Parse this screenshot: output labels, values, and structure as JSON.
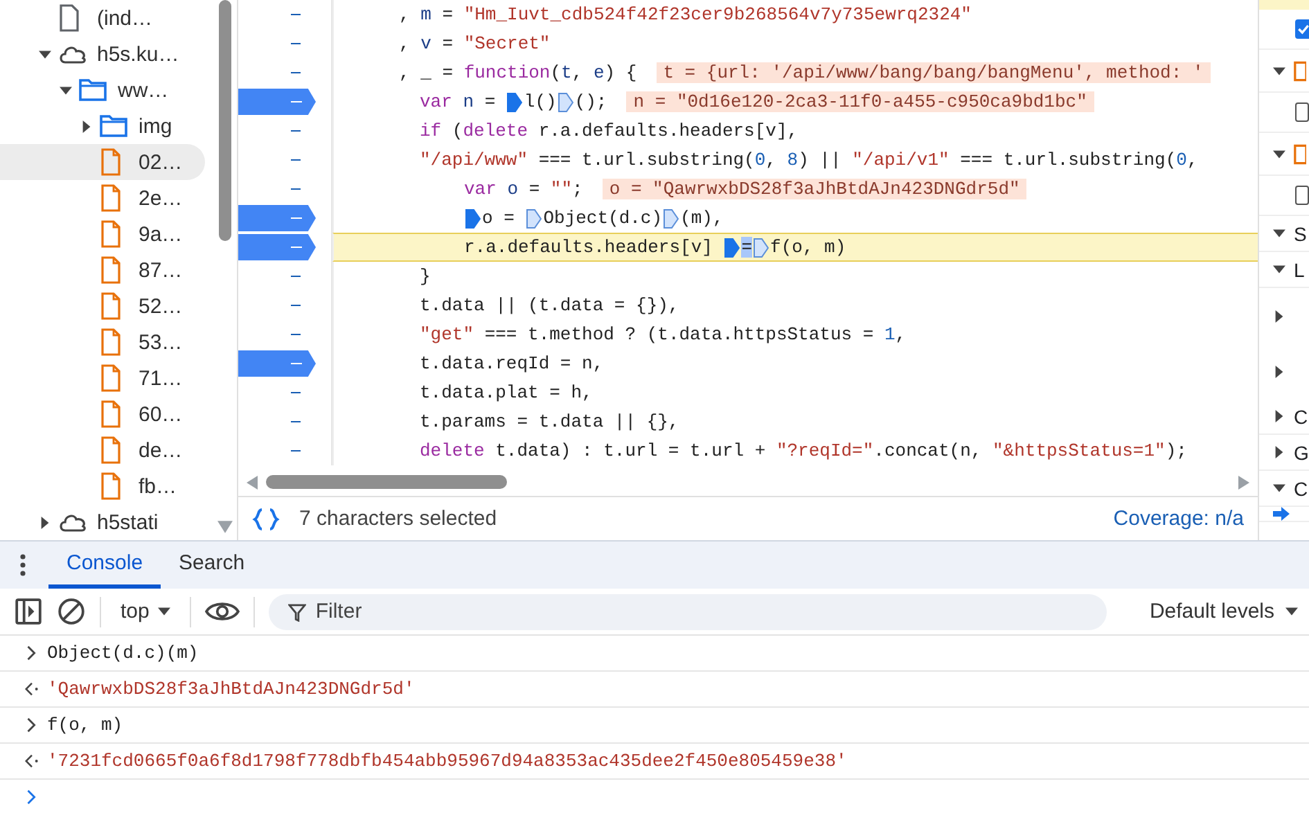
{
  "file_tree": [
    {
      "kind": "page",
      "label": "(ind…",
      "selected": false
    },
    {
      "kind": "cloud",
      "label": "h5s.ku…",
      "expanded": true,
      "selected": false,
      "children": [
        {
          "kind": "folder",
          "label": "ww…",
          "expanded": true,
          "selected": false,
          "children": [
            {
              "kind": "folder",
              "label": "img",
              "expanded": false,
              "selected": false
            },
            {
              "kind": "script",
              "label": "02…",
              "selected": true
            },
            {
              "kind": "script",
              "label": "2e…",
              "selected": false
            },
            {
              "kind": "script",
              "label": "9a…",
              "selected": false
            },
            {
              "kind": "script",
              "label": "87…",
              "selected": false
            },
            {
              "kind": "script",
              "label": "52…",
              "selected": false
            },
            {
              "kind": "script",
              "label": "53…",
              "selected": false
            },
            {
              "kind": "script",
              "label": "71…",
              "selected": false
            },
            {
              "kind": "script",
              "label": "60…",
              "selected": false
            },
            {
              "kind": "script",
              "label": "de…",
              "selected": false
            },
            {
              "kind": "script",
              "label": "fb…",
              "selected": false
            }
          ]
        }
      ]
    },
    {
      "kind": "cloud",
      "label": "h5stati",
      "expanded": false,
      "selected": false
    }
  ],
  "code": {
    "lines": [
      {
        "breakpoint": false,
        "current": false,
        "parts": [
          {
            "kind": "code",
            "tokens": [
              {
                "text": ", ",
                "kind": "plain"
              },
              {
                "text": "m",
                "kind": "def"
              },
              {
                "text": " = ",
                "kind": "plain"
              },
              {
                "text": "\"Hm_Iuvt_cdb524f42f23cer9b268564v7y735ewrq2324\"",
                "kind": "str"
              }
            ]
          }
        ]
      },
      {
        "breakpoint": false,
        "current": false,
        "parts": [
          {
            "kind": "code",
            "tokens": [
              {
                "text": ", ",
                "kind": "plain"
              },
              {
                "text": "v",
                "kind": "def"
              },
              {
                "text": " = ",
                "kind": "plain"
              },
              {
                "text": "\"Secret\"",
                "kind": "str"
              }
            ]
          }
        ]
      },
      {
        "breakpoint": false,
        "current": false,
        "parts": [
          {
            "kind": "code",
            "tokens": [
              {
                "text": ", _ = ",
                "kind": "plain"
              },
              {
                "text": "function",
                "kind": "kw"
              },
              {
                "text": "(",
                "kind": "plain"
              },
              {
                "text": "t",
                "kind": "def"
              },
              {
                "text": ", ",
                "kind": "plain"
              },
              {
                "text": "e",
                "kind": "def"
              },
              {
                "text": ") {",
                "kind": "plain"
              }
            ]
          },
          {
            "kind": "value",
            "text": "t = {url: '/api/www/bang/bang/bangMenu', method: '"
          }
        ],
        "children": [
          {
            "breakpoint": true,
            "current": false,
            "parts": [
              {
                "kind": "code",
                "tokens": [
                  {
                    "text": "var",
                    "kind": "kw"
                  },
                  {
                    "text": " n",
                    "kind": "def"
                  },
                  {
                    "text": " = ",
                    "kind": "plain"
                  }
                ]
              },
              {
                "kind": "marker",
                "active": true
              },
              {
                "kind": "code",
                "tokens": [
                  {
                    "text": "l()",
                    "kind": "plain"
                  }
                ]
              },
              {
                "kind": "marker",
                "active": false
              },
              {
                "kind": "code",
                "tokens": [
                  {
                    "text": "();",
                    "kind": "plain"
                  }
                ]
              },
              {
                "kind": "value",
                "text": "n = \"0d16e120-2ca3-11f0-a455-c950ca9bd1bc\""
              }
            ]
          },
          {
            "breakpoint": false,
            "current": false,
            "parts": [
              {
                "kind": "code",
                "tokens": [
                  {
                    "text": "if",
                    "kind": "kw"
                  },
                  {
                    "text": " (",
                    "kind": "plain"
                  },
                  {
                    "text": "delete",
                    "kind": "kw"
                  },
                  {
                    "text": " r.a.defaults.headers[v],",
                    "kind": "plain"
                  }
                ]
              }
            ]
          },
          {
            "breakpoint": false,
            "current": false,
            "parts": [
              {
                "kind": "code",
                "tokens": [
                  {
                    "text": "\"/api/www\"",
                    "kind": "str"
                  },
                  {
                    "text": " === t.url.substring(",
                    "kind": "plain"
                  },
                  {
                    "text": "0",
                    "kind": "num"
                  },
                  {
                    "text": ", ",
                    "kind": "plain"
                  },
                  {
                    "text": "8",
                    "kind": "num"
                  },
                  {
                    "text": ") || ",
                    "kind": "plain"
                  },
                  {
                    "text": "\"/api/v1\"",
                    "kind": "str"
                  },
                  {
                    "text": " === t.url.substring(",
                    "kind": "plain"
                  },
                  {
                    "text": "0",
                    "kind": "num"
                  },
                  {
                    "text": ",",
                    "kind": "plain"
                  }
                ]
              }
            ],
            "children": [
              {
                "breakpoint": false,
                "current": false,
                "parts": [
                  {
                    "kind": "code",
                    "tokens": [
                      {
                        "text": "var",
                        "kind": "kw"
                      },
                      {
                        "text": " o",
                        "kind": "def"
                      },
                      {
                        "text": " = ",
                        "kind": "plain"
                      },
                      {
                        "text": "\"\"",
                        "kind": "str"
                      },
                      {
                        "text": ";",
                        "kind": "plain"
                      }
                    ]
                  },
                  {
                    "kind": "value",
                    "text": "o = \"QawrwxbDS28f3aJhBtdAJn423DNGdr5d\""
                  }
                ]
              },
              {
                "breakpoint": true,
                "current": false,
                "parts": [
                  {
                    "kind": "marker",
                    "active": true
                  },
                  {
                    "kind": "code",
                    "tokens": [
                      {
                        "text": "o = ",
                        "kind": "plain"
                      }
                    ]
                  },
                  {
                    "kind": "marker",
                    "active": false
                  },
                  {
                    "kind": "code",
                    "tokens": [
                      {
                        "text": "Object(d.c)",
                        "kind": "plain"
                      }
                    ]
                  },
                  {
                    "kind": "marker",
                    "active": false
                  },
                  {
                    "kind": "code",
                    "tokens": [
                      {
                        "text": "(m),",
                        "kind": "plain"
                      }
                    ]
                  }
                ]
              },
              {
                "breakpoint": true,
                "current": true,
                "parts": [
                  {
                    "kind": "code",
                    "tokens": [
                      {
                        "text": "r.a.defaults.headers[v] ",
                        "kind": "plain"
                      }
                    ]
                  },
                  {
                    "kind": "marker",
                    "active": true
                  },
                  {
                    "kind": "code",
                    "tokens": [
                      {
                        "text": "=",
                        "kind": "sel"
                      }
                    ]
                  },
                  {
                    "kind": "marker",
                    "active": false
                  },
                  {
                    "kind": "code",
                    "tokens": [
                      {
                        "text": "f(o, m)",
                        "kind": "plain"
                      }
                    ]
                  }
                ]
              }
            ]
          },
          {
            "breakpoint": false,
            "current": false,
            "parts": [
              {
                "kind": "code",
                "tokens": [
                  {
                    "text": "}",
                    "kind": "plain"
                  }
                ]
              }
            ]
          },
          {
            "breakpoint": false,
            "current": false,
            "parts": [
              {
                "kind": "code",
                "tokens": [
                  {
                    "text": "t.data || (t.data = {}),",
                    "kind": "plain"
                  }
                ]
              }
            ]
          },
          {
            "breakpoint": false,
            "current": false,
            "parts": [
              {
                "kind": "code",
                "tokens": [
                  {
                    "text": "\"get\"",
                    "kind": "str"
                  },
                  {
                    "text": " === t.method ? (t.data.httpsStatus = ",
                    "kind": "plain"
                  },
                  {
                    "text": "1",
                    "kind": "num"
                  },
                  {
                    "text": ",",
                    "kind": "plain"
                  }
                ]
              }
            ]
          },
          {
            "breakpoint": true,
            "current": false,
            "parts": [
              {
                "kind": "code",
                "tokens": [
                  {
                    "text": "t.data.reqId = n,",
                    "kind": "plain"
                  }
                ]
              }
            ]
          },
          {
            "breakpoint": false,
            "current": false,
            "parts": [
              {
                "kind": "code",
                "tokens": [
                  {
                    "text": "t.data.plat = h,",
                    "kind": "plain"
                  }
                ]
              }
            ]
          },
          {
            "breakpoint": false,
            "current": false,
            "parts": [
              {
                "kind": "code",
                "tokens": [
                  {
                    "text": "t.params = t.data || {},",
                    "kind": "plain"
                  }
                ]
              }
            ]
          },
          {
            "breakpoint": false,
            "current": false,
            "parts": [
              {
                "kind": "code",
                "tokens": [
                  {
                    "text": "delete",
                    "kind": "kw"
                  },
                  {
                    "text": " t.data) : t.url = t.url + ",
                    "kind": "plain"
                  },
                  {
                    "text": "\"?reqId=\"",
                    "kind": "str"
                  },
                  {
                    "text": ".concat(n, ",
                    "kind": "plain"
                  },
                  {
                    "text": "\"&httpsStatus=1\"",
                    "kind": "str"
                  },
                  {
                    "text": ");",
                    "kind": "plain"
                  }
                ]
              }
            ]
          }
        ]
      }
    ]
  },
  "status_bar": {
    "selection": "7 characters selected",
    "coverage": "Coverage: n/a"
  },
  "debugger_pane": [
    {
      "kind": "checkbox",
      "checked": true
    },
    {
      "kind": "group",
      "expanded": true
    },
    {
      "kind": "checkbox",
      "checked": false
    },
    {
      "kind": "group",
      "expanded": true
    },
    {
      "kind": "checkbox",
      "checked": false
    },
    {
      "kind": "section",
      "expanded": true,
      "label": "S"
    },
    {
      "kind": "section",
      "expanded": true,
      "label": "L"
    },
    {
      "kind": "toggle",
      "expanded": false
    },
    {
      "kind": "toggle",
      "expanded": false
    },
    {
      "kind": "section",
      "expanded": false,
      "label": "C"
    },
    {
      "kind": "section",
      "expanded": false,
      "label": "G"
    },
    {
      "kind": "section",
      "expanded": true,
      "label": "C"
    }
  ],
  "drawer": {
    "tabs": [
      {
        "label": "Console",
        "selected": true
      },
      {
        "label": "Search",
        "selected": false
      }
    ],
    "context": "top",
    "filter": {
      "placeholder": "Filter"
    },
    "levels": "Default levels",
    "messages": [
      {
        "kind": "input",
        "text": "Object(d.c)(m)"
      },
      {
        "kind": "result",
        "text": "'QawrwxbDS28f3aJhBtdAJn423DNGdr5d'"
      },
      {
        "kind": "input",
        "text": "f(o, m)"
      },
      {
        "kind": "result",
        "text": "'7231fcd0665f0a6f8d1798f778dbfb454abb95967d94a8353ac435dee2f450e805459e38'"
      }
    ]
  }
}
